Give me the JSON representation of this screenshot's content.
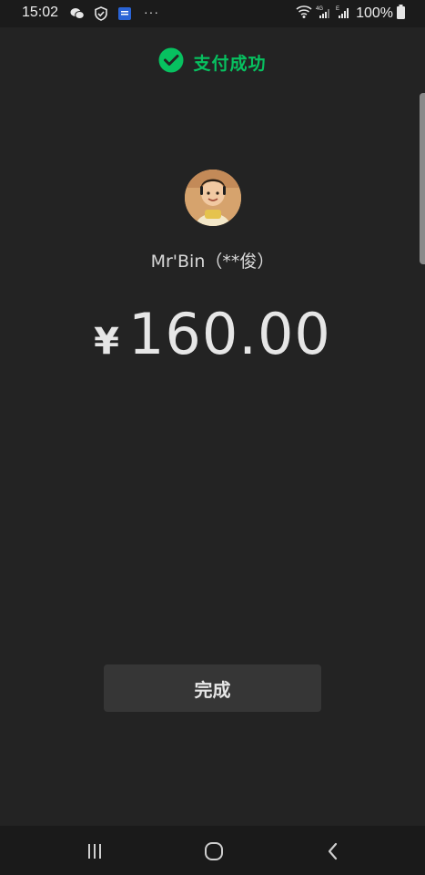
{
  "status_bar": {
    "time": "15:02",
    "battery": "100%",
    "network": "4G",
    "network2": "E",
    "more": "···"
  },
  "header": {
    "title": "支付成功",
    "icon": "wechat-icon",
    "accent_color": "#07c160"
  },
  "payee": {
    "name": "Mr'Bin（**俊）"
  },
  "payment": {
    "currency": "¥",
    "amount": "160.00"
  },
  "actions": {
    "done_label": "完成"
  },
  "nav": {
    "items": [
      "recents-icon",
      "home-icon",
      "back-icon"
    ]
  }
}
